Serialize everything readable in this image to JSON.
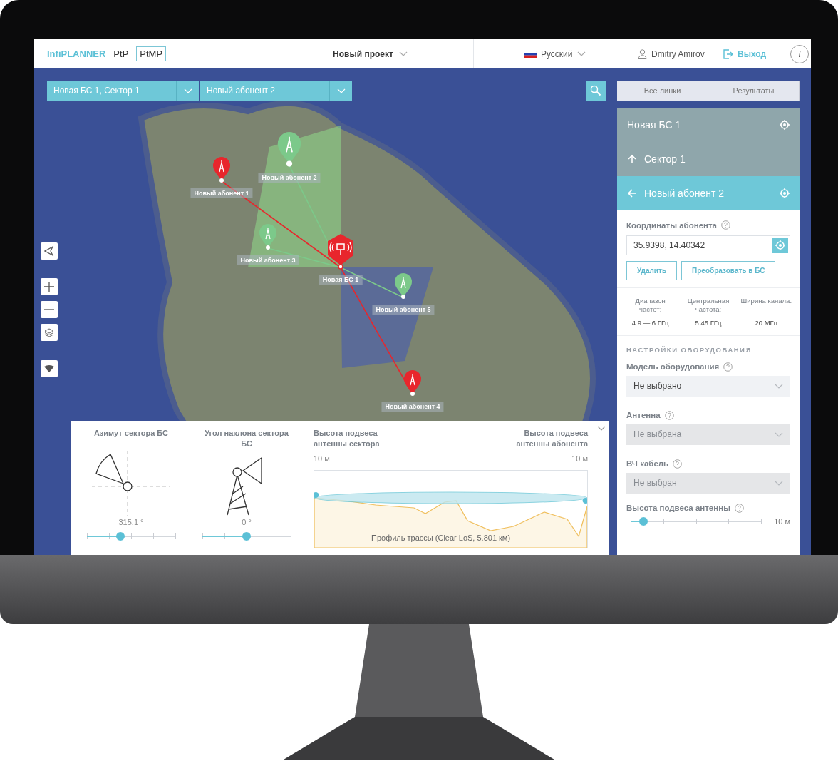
{
  "header": {
    "logo": "InfiPLANNER",
    "modes": [
      {
        "label": "PtP",
        "selected": false
      },
      {
        "label": "PtMP",
        "selected": true
      }
    ],
    "project": "Новый проект",
    "language": "Русский",
    "user": "Dmitry Amirov",
    "logout": "Выход",
    "info": "i"
  },
  "map": {
    "selectors": [
      {
        "value": "Новая БС 1, Сектор 1"
      },
      {
        "value": "Новый абонент 2"
      }
    ],
    "markers": [
      {
        "kind": "subscriber",
        "label": "Новый абонент 1",
        "color": "#e8262c",
        "selected": false
      },
      {
        "kind": "subscriber",
        "label": "Новый абонент 2",
        "color": "#7cc98a",
        "selected": true
      },
      {
        "kind": "subscriber",
        "label": "Новый абонент 3",
        "color": "#7cc98a",
        "selected": false
      },
      {
        "kind": "base_station",
        "label": "Новая БС 1",
        "color": "#e8262c",
        "selected": false
      },
      {
        "kind": "subscriber",
        "label": "Новый абонент 5",
        "color": "#7cc98a",
        "selected": false
      },
      {
        "kind": "subscriber",
        "label": "Новый абонент 4",
        "color": "#e8262c",
        "selected": false
      }
    ]
  },
  "side_panel": {
    "tabs": [
      "Все линки",
      "Результаты"
    ],
    "tree": [
      {
        "kind": "bs",
        "label": "Новая БС 1",
        "selected": false
      },
      {
        "kind": "sector",
        "label": "Сектор 1",
        "selected": false
      },
      {
        "kind": "subscriber",
        "label": "Новый абонент 2",
        "selected": true
      }
    ],
    "coordinates": {
      "label": "Координаты абонента",
      "value": "35.9398, 14.40342"
    },
    "actions": [
      "Удалить",
      "Преобразовать в БС"
    ],
    "stats": [
      {
        "label": "Диапазон частот:",
        "value": "4.9 — 6 ГГц"
      },
      {
        "label": "Центральная частота:",
        "value": "5.45 ГГц"
      },
      {
        "label": "Ширина канала:",
        "value": "20 МГц"
      }
    ],
    "section": "НАСТРОЙКИ ОБОРУДОВАНИЯ",
    "fields": [
      {
        "label": "Модель оборудования",
        "value": "Не выбрано",
        "disabled": false
      },
      {
        "label": "Антенна",
        "value": "Не выбрана",
        "disabled": true
      },
      {
        "label": "ВЧ кабель",
        "value": "Не выбран",
        "disabled": true
      }
    ],
    "height": {
      "label": "Высота подвеса антенны",
      "level": 0.1,
      "reading": "10 м"
    }
  },
  "bottom_panel": {
    "azimuth": {
      "title": "Азимут сектора БС",
      "reading": "315.1 °",
      "level": 0.375
    },
    "tilt": {
      "title": "Угол наклона сектора БС",
      "reading": "0 °",
      "level": 0.5
    },
    "profile": {
      "left_title": "Высота подвеса антенны сектора",
      "left_value": "10 м",
      "right_title": "Высота подвеса антенны абонента",
      "right_value": "10 м",
      "caption": "Профиль трассы (Clear LoS, 5.801 км)"
    }
  }
}
